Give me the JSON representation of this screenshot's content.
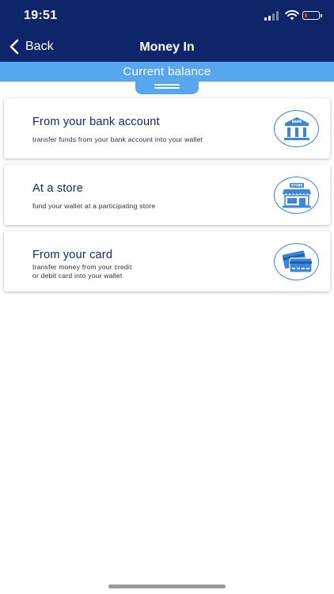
{
  "status_bar": {
    "time": "19:51"
  },
  "nav": {
    "back_label": "Back",
    "title": "Money In"
  },
  "balance": {
    "label": "Current balance"
  },
  "options": [
    {
      "title": "From your bank account",
      "description": "transfer funds from your bank account into your wallet",
      "icon": "bank-icon",
      "icon_text": "BANK"
    },
    {
      "title": "At a store",
      "description": "fund your wallet at a participating store",
      "icon": "store-icon",
      "icon_text": "STORE"
    },
    {
      "title": "From your card",
      "description_line1": "transfer money from your credit",
      "description_line2": "or debit card into your wallet",
      "icon": "credit-card-icon"
    }
  ],
  "colors": {
    "header": "#0f2569",
    "accent": "#56a7ee",
    "icon_blue": "#3a86dc"
  }
}
